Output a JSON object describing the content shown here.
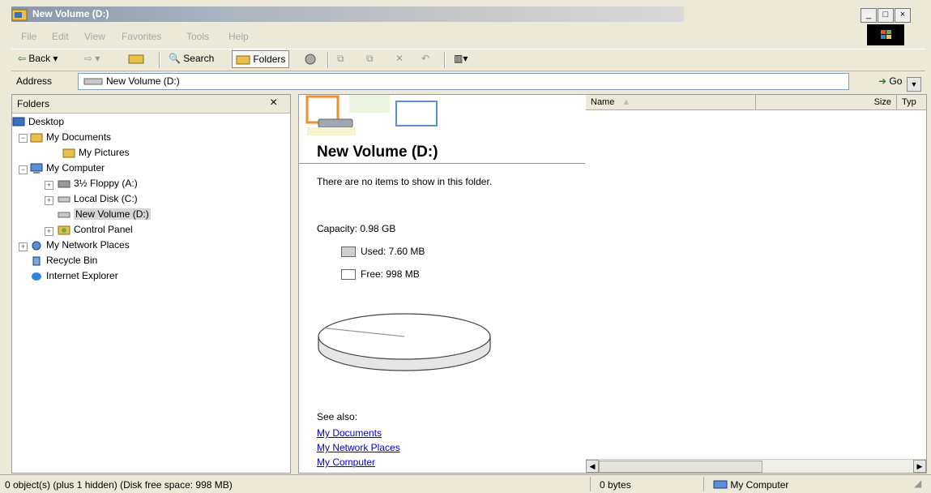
{
  "window": {
    "title": "New Volume (D:)",
    "buttons": {
      "minimize": "_",
      "maximize": "□",
      "close": "×"
    }
  },
  "menu": [
    "File",
    "Edit",
    "View",
    "Favorites",
    "Tools",
    "Help"
  ],
  "toolbar": {
    "back": "Back",
    "search": "Search",
    "folders": "Folders",
    "views_icon": "views-icon"
  },
  "address": {
    "label": "Address",
    "value": "New Volume (D:)",
    "go": "Go"
  },
  "folders_pane": {
    "title": "Folders",
    "close": "×",
    "tree": [
      {
        "label": "Desktop",
        "icon": "desktop-icon",
        "level": 0,
        "expander": ""
      },
      {
        "label": "My Documents",
        "icon": "folder-icon",
        "level": 1,
        "expander": "−"
      },
      {
        "label": "My Pictures",
        "icon": "folder-icon",
        "level": 2,
        "expander": ""
      },
      {
        "label": "My Computer",
        "icon": "computer-icon",
        "level": 1,
        "expander": "−"
      },
      {
        "label": "3½ Floppy (A:)",
        "icon": "floppy-icon",
        "level": 2,
        "expander": "+"
      },
      {
        "label": "Local Disk (C:)",
        "icon": "drive-icon",
        "level": 2,
        "expander": "+"
      },
      {
        "label": "New Volume (D:)",
        "icon": "drive-icon",
        "level": 2,
        "expander": "",
        "selected": true
      },
      {
        "label": "Control Panel",
        "icon": "control-panel-icon",
        "level": 2,
        "expander": "+"
      },
      {
        "label": "My Network Places",
        "icon": "network-icon",
        "level": 1,
        "expander": "+"
      },
      {
        "label": "Recycle Bin",
        "icon": "recycle-bin-icon",
        "level": 1,
        "expander": ""
      },
      {
        "label": "Internet Explorer",
        "icon": "ie-icon",
        "level": 1,
        "expander": ""
      }
    ]
  },
  "task_panel": {
    "heading": "New Volume (D:)",
    "empty_message": "There are no items to show in this folder.",
    "capacity": "Capacity: 0.98 GB",
    "used": "Used: 7.60 MB",
    "free": "Free: 998 MB",
    "used_fraction": 0.0076,
    "see_also_label": "See also:",
    "links": [
      "My Documents",
      "My Network Places",
      "My Computer"
    ]
  },
  "file_list": {
    "columns": [
      "Name",
      "Size",
      "Typ"
    ]
  },
  "status": {
    "objects": "0 object(s) (plus 1 hidden) (Disk free space: 998 MB)",
    "size": "0 bytes",
    "zone": "My Computer"
  },
  "colors": {
    "chrome": "#ece9d8",
    "link": "#0000cc",
    "selection": "#d6d6d6"
  }
}
